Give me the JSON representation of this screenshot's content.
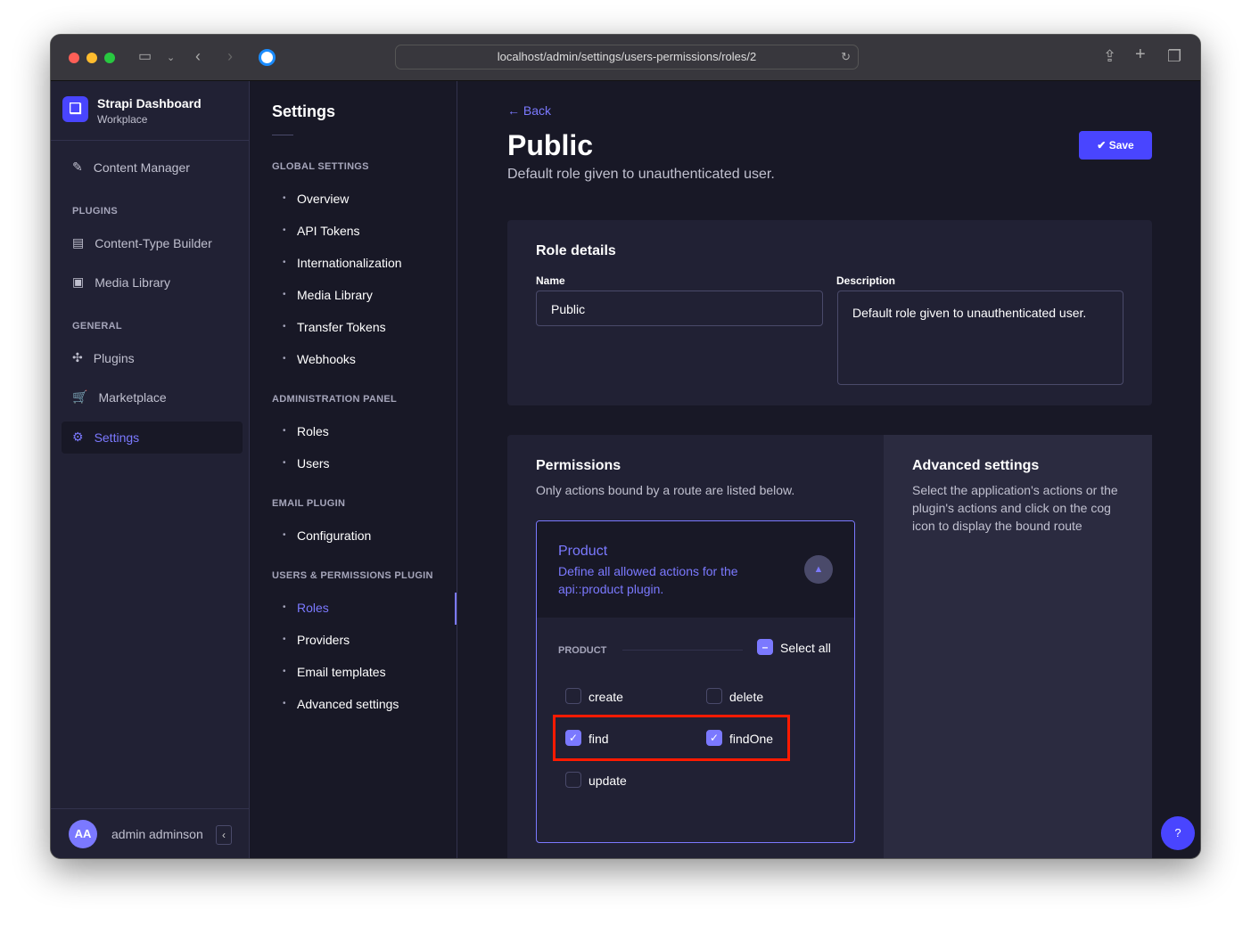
{
  "browser": {
    "url": "localhost/admin/settings/users-permissions/roles/2"
  },
  "brand": {
    "title": "Strapi Dashboard",
    "subtitle": "Workplace"
  },
  "sidebar": {
    "content_manager": "Content Manager",
    "plugins_heading": "PLUGINS",
    "ctb": "Content-Type Builder",
    "media": "Media Library",
    "general_heading": "GENERAL",
    "plugins": "Plugins",
    "marketplace": "Marketplace",
    "settings": "Settings",
    "user_initials": "AA",
    "user_name": "admin adminson"
  },
  "settings_nav": {
    "title": "Settings",
    "sections": [
      {
        "heading": "GLOBAL SETTINGS",
        "items": [
          "Overview",
          "API Tokens",
          "Internationalization",
          "Media Library",
          "Transfer Tokens",
          "Webhooks"
        ]
      },
      {
        "heading": "ADMINISTRATION PANEL",
        "items": [
          "Roles",
          "Users"
        ]
      },
      {
        "heading": "EMAIL PLUGIN",
        "items": [
          "Configuration"
        ]
      },
      {
        "heading": "USERS & PERMISSIONS PLUGIN",
        "items": [
          "Roles",
          "Providers",
          "Email templates",
          "Advanced settings"
        ]
      }
    ],
    "active": "Roles"
  },
  "page": {
    "back": "Back",
    "title": "Public",
    "subtitle": "Default role given to unauthenticated user.",
    "save": "Save"
  },
  "role_details": {
    "heading": "Role details",
    "name_label": "Name",
    "name_value": "Public",
    "desc_label": "Description",
    "desc_value": "Default role given to unauthenticated user."
  },
  "permissions": {
    "heading": "Permissions",
    "subtitle": "Only actions bound by a route are listed below.",
    "group_title": "Product",
    "group_desc": "Define all allowed actions for the api::product plugin.",
    "section": "PRODUCT",
    "select_all": "Select all",
    "actions": [
      {
        "label": "create",
        "checked": false
      },
      {
        "label": "delete",
        "checked": false
      },
      {
        "label": "find",
        "checked": true
      },
      {
        "label": "findOne",
        "checked": true
      },
      {
        "label": "update",
        "checked": false
      }
    ]
  },
  "advanced": {
    "heading": "Advanced settings",
    "text": "Select the application's actions or the plugin's actions and click on the cog icon to display the bound route"
  },
  "help": "?",
  "colors": {
    "accent": "#4945ff",
    "primary_light": "#7b79ff",
    "highlight": "#ff1a00"
  }
}
